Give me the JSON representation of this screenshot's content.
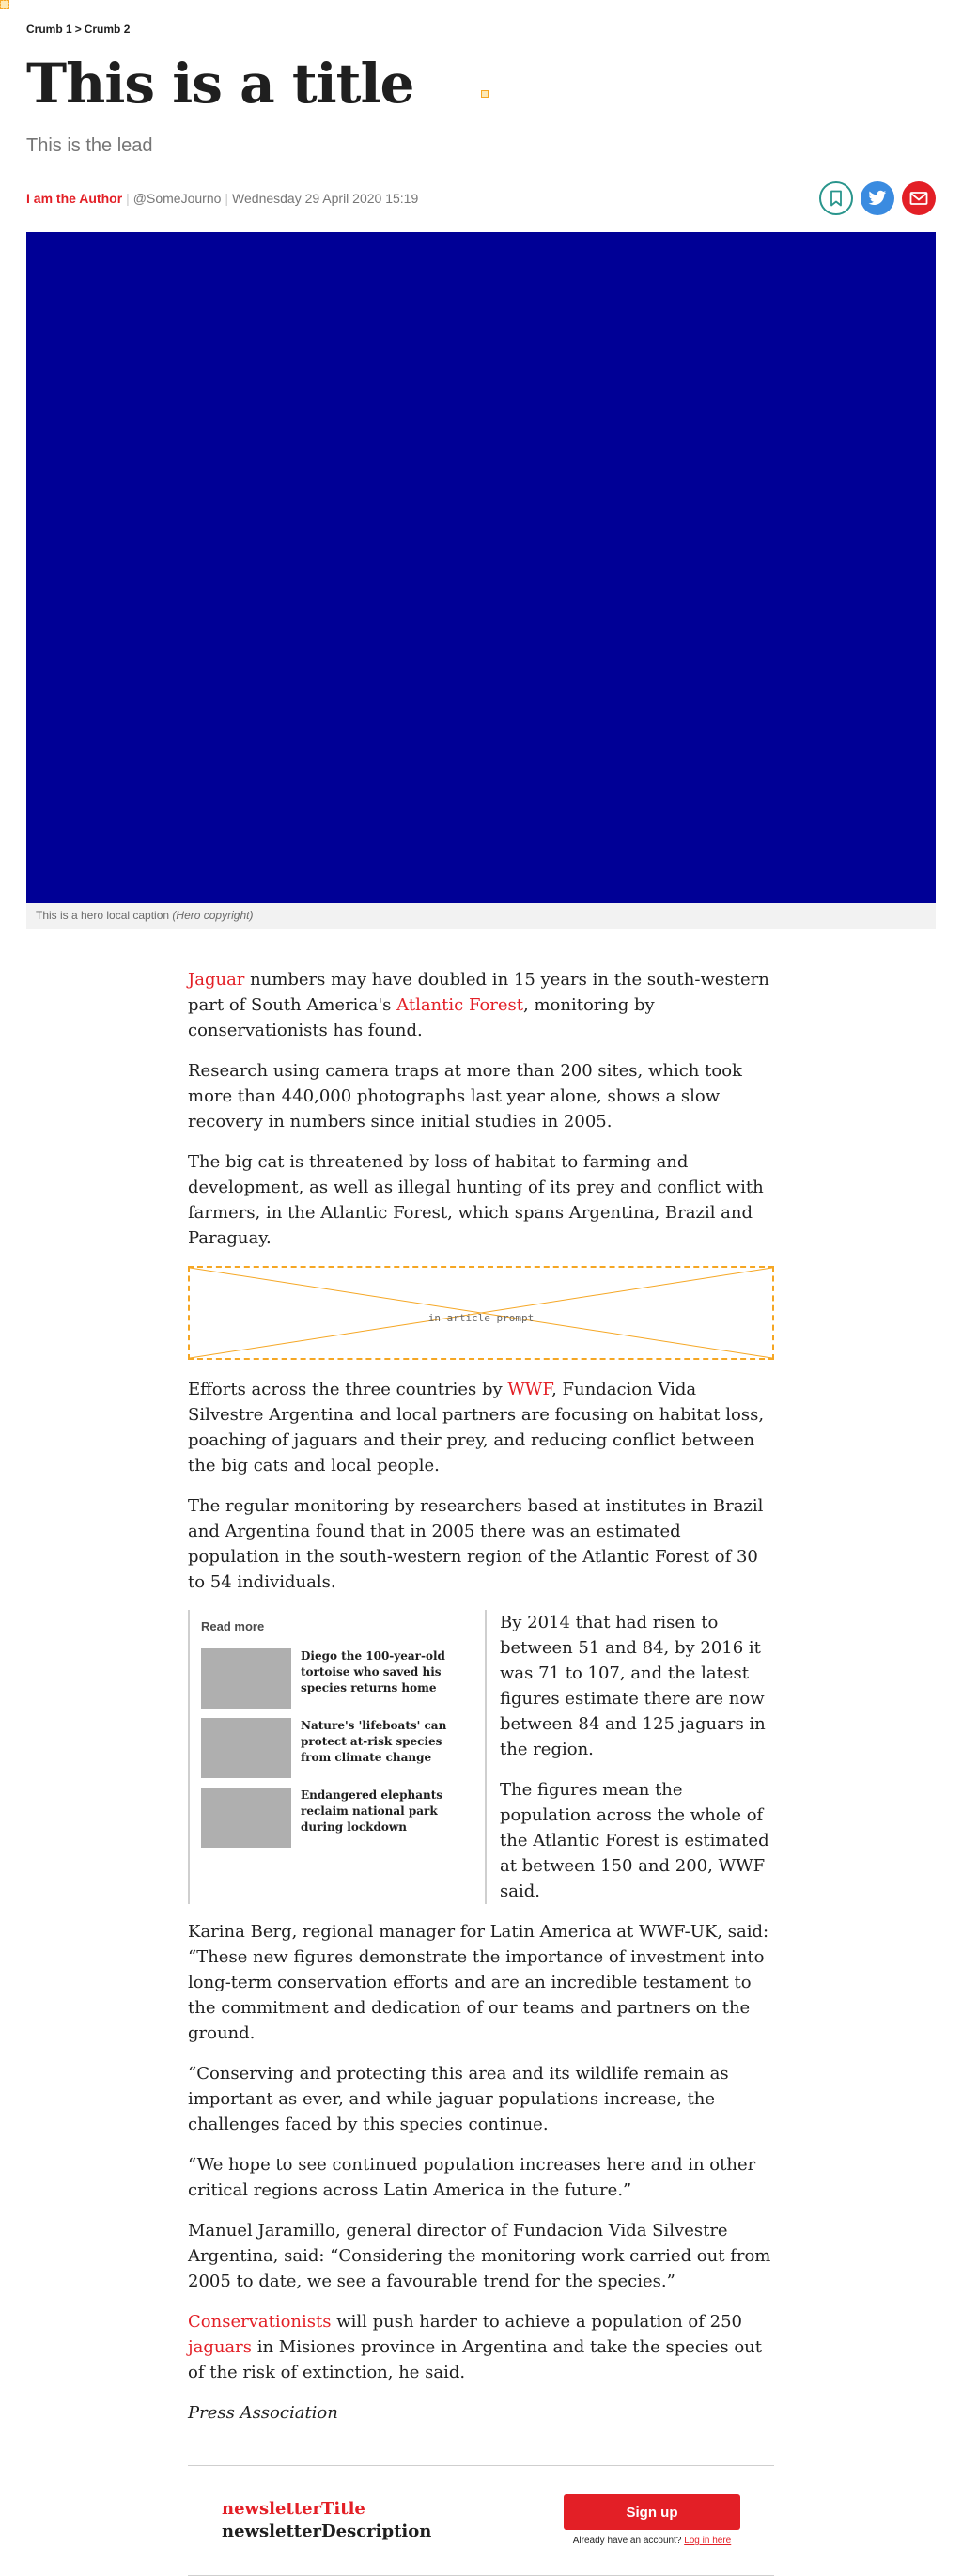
{
  "breadcrumb": {
    "crumb1": "Crumb 1",
    "separator": ">",
    "crumb2": "Crumb 2"
  },
  "article_header": {
    "title": "This is a title",
    "lead": "This is the lead"
  },
  "byline": {
    "author": "I am the Author",
    "handle": "@SomeJourno",
    "date": "Wednesday 29 April 2020 15:19",
    "separator": "|"
  },
  "share": {
    "bookmark_icon": "bookmark-icon",
    "twitter_icon": "twitter-icon",
    "email_icon": "email-icon",
    "bookmark_color": "#29958c",
    "twitter_color": "#3a8be0",
    "email_color": "#e31f26"
  },
  "hero": {
    "image_color": "#000096",
    "caption": "This is a hero local caption",
    "copyright": "(Hero copyright)"
  },
  "body": {
    "p1_link1": "Jaguar",
    "p1_text1": " numbers may have doubled in 15 years in the south-western part of South America's ",
    "p1_link2": "Atlantic Forest",
    "p1_text2": ", monitoring by conservationists has found.",
    "p2": "Research using camera traps at more than 200 sites, which took more than 440,000 photographs last year alone, shows a slow recovery in numbers since initial studies in 2005.",
    "p3": "The big cat is threatened by loss of habitat to farming and development, as well as illegal hunting of its prey and conflict with farmers, in the Atlantic Forest, which spans Argentina, Brazil and Paraguay.",
    "prompt_label": "in article prompt",
    "p4_text1": "Efforts across the three countries by ",
    "p4_link": "WWF",
    "p4_text2": ", Fundacion Vida Silvestre Argentina and local partners are focusing on habitat loss, poaching of jaguars and their prey, and reducing conflict between the big cats and local people.",
    "p5": "The regular monitoring by researchers based at institutes in Brazil and Argentina found that in 2005 there was an estimated population in the south-western region of the Atlantic Forest of 30 to 54 individuals.",
    "p6": "By 2014 that had risen to between 51 and 84, by 2016 it was 71 to 107, and the latest figures estimate there are now between 84 and 125 jaguars in the region.",
    "p7": "The figures mean the population across the whole of the Atlantic Forest is estimated at between 150 and 200, WWF said.",
    "p8": "Karina Berg, regional manager for Latin America at WWF-UK, said: “These new figures demonstrate the importance of investment into long-term conservation efforts and are an incredible testament to the commitment and dedication of our teams and partners on the ground.",
    "p9": "“Conserving and protecting this area and its wildlife remain as important as ever, and while jaguar populations increase, the challenges faced by this species continue.",
    "p10": "“We hope to see continued population increases here and in other critical regions across Latin America in the future.”",
    "p11": "Manuel Jaramillo, general director of Fundacion Vida Silvestre Argentina, said: “Considering the monitoring work carried out from 2005 to date, we see a favourable trend for the species.”",
    "p12_link1": "Conservationists",
    "p12_text1": " will push harder to achieve a population of 250 ",
    "p12_link2": "jaguars",
    "p12_text2": " in Misiones province in Argentina and take the species out of the risk of extinction, he said.",
    "credit": "Press Association"
  },
  "read_more": {
    "heading": "Read more",
    "items": [
      {
        "title": "Diego the 100-year-old tortoise who saved his species returns home"
      },
      {
        "title": "Nature's 'lifeboats' can protect at-risk species from climate change"
      },
      {
        "title": "Endangered elephants reclaim national park during lockdown"
      }
    ]
  },
  "newsletter": {
    "title": "newsletterTitle",
    "description": "newsletterDescription",
    "signup_label": "Sign up",
    "login_prompt": "Already have an account?",
    "login_link": "Log in here"
  }
}
